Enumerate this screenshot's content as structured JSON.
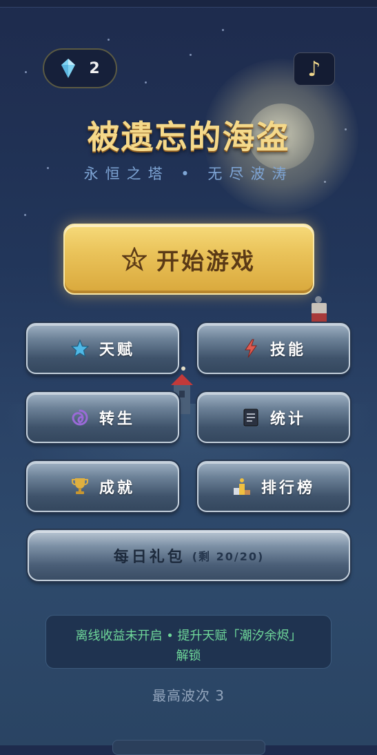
{
  "resources": {
    "gems": "2"
  },
  "music": {
    "icon": "music-note-icon",
    "glyph": "♪"
  },
  "title": "被遗忘的海盗",
  "subtitle": "永恒之塔 • 无尽波涛",
  "start_button": {
    "label": "开始游戏",
    "icon": "rank-star-icon",
    "rank": "1"
  },
  "menu": [
    {
      "id": "talent",
      "label": "天赋",
      "icon": "star-icon",
      "color": "#4fb8e6"
    },
    {
      "id": "skill",
      "label": "技能",
      "icon": "lightning-icon",
      "color": "#e05a4f"
    },
    {
      "id": "rebirth",
      "label": "转生",
      "icon": "swirl-icon",
      "color": "#9a6ad8"
    },
    {
      "id": "stats",
      "label": "统计",
      "icon": "document-icon",
      "color": "#2a3140"
    },
    {
      "id": "achievements",
      "label": "成就",
      "icon": "trophy-icon",
      "color": "#e0b040"
    },
    {
      "id": "leaderboard",
      "label": "排行榜",
      "icon": "podium-icon",
      "color": "#f0c040"
    }
  ],
  "daily_gift": {
    "label": "每日礼包",
    "remaining": "(剩 20/20)"
  },
  "offline_notice": {
    "line1": "离线收益未开启 • 提升天赋「潮汐余烬」",
    "line2": "解锁"
  },
  "best_wave": "最高波次 3",
  "colors": {
    "accent_gold": "#f5d98a",
    "notice_green": "#6fd89a",
    "subtitle_blue": "#7fa6d6"
  }
}
